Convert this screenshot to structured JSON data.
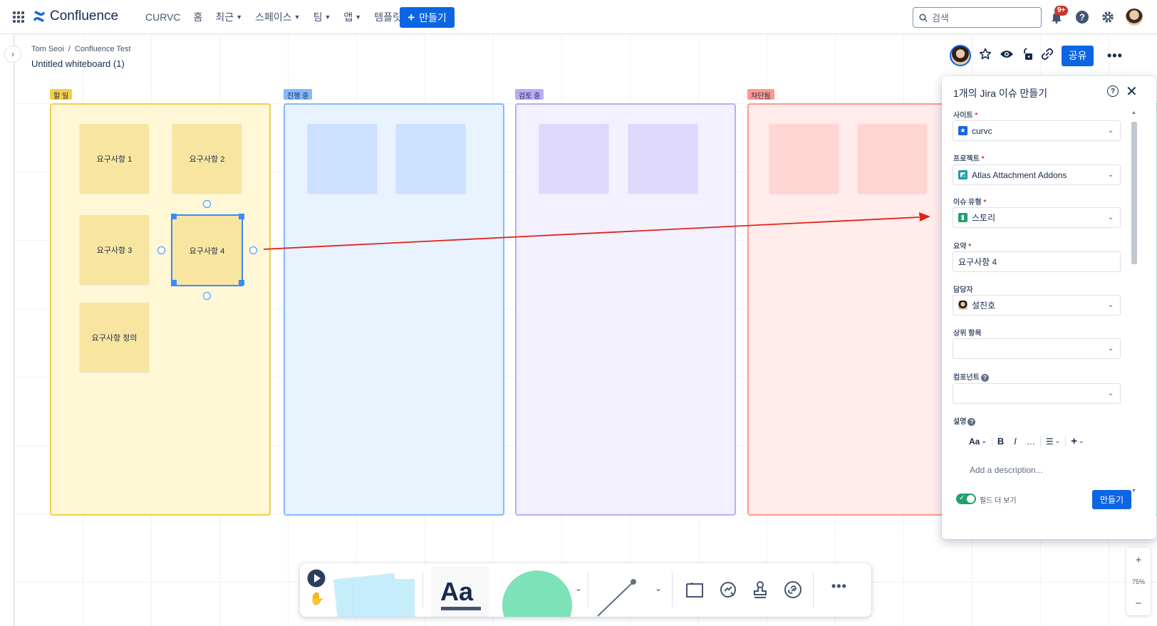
{
  "nav": {
    "logo": "Confluence",
    "items": [
      "CURVC",
      "홈",
      "최근",
      "스페이스",
      "팀",
      "앱",
      "템플릿"
    ],
    "create_label": "만들기",
    "search_placeholder": "검색",
    "notification_badge": "9+"
  },
  "page": {
    "breadcrumb": [
      "Tom Seoi",
      "Confluence Test"
    ],
    "breadcrumb_sep": "/",
    "title": "Untitled whiteboard (1)",
    "share_label": "공유"
  },
  "columns": [
    {
      "label": "할 일",
      "color": "#f8e6a0",
      "border": "#f5cd47",
      "bg": "#fff7d6"
    },
    {
      "label": "진행 중",
      "color": "#85b8ff",
      "border": "#85b8ff",
      "bg": "#e9f2ff"
    },
    {
      "label": "검토 중",
      "color": "#b8acf6",
      "border": "#b8acf6",
      "bg": "#f3f0ff"
    },
    {
      "label": "차단됨",
      "color": "#fd9891",
      "border": "#fd9891",
      "bg": "#ffeceb"
    }
  ],
  "stickies": [
    "요구사항 1",
    "요구사항 2",
    "요구사항 3",
    "요구사항 4",
    "요구사항 정의"
  ],
  "jira": {
    "title": "1개의 Jira 이슈 만들기",
    "required_mark": "*",
    "site_label": "사이트",
    "site_value": "curvc",
    "project_label": "프로젝트",
    "project_value": "Atlas Attachment Addons",
    "issue_type_label": "이슈 유형",
    "issue_type_value": "스토리",
    "summary_label": "요약",
    "summary_value": "요구사항 4",
    "assignee_label": "담당자",
    "assignee_value": "설진호",
    "parent_label": "상위 항목",
    "component_label": "컴포넌트",
    "description_label": "설명",
    "editor_text_style": "Aa",
    "description_placeholder": "Add a description...",
    "more_fields_label": "필드 더 보기",
    "submit_label": "만들기"
  },
  "zoom": {
    "level": "75%",
    "plus": "+",
    "minus": "−"
  },
  "toolbar": {
    "text_tool_label": "Aa"
  }
}
